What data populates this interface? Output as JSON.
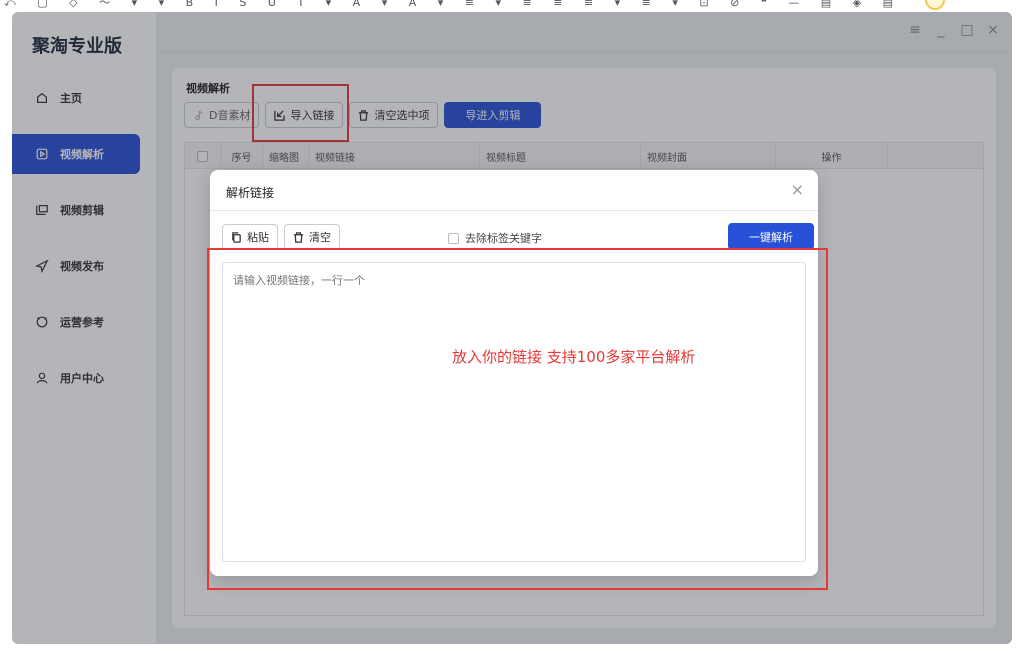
{
  "sidebar": {
    "brand": "聚淘专业版",
    "items": [
      {
        "label": "主页",
        "icon": "home-icon"
      },
      {
        "label": "视频解析",
        "icon": "play-icon"
      },
      {
        "label": "视频剪辑",
        "icon": "edit-icon"
      },
      {
        "label": "视频发布",
        "icon": "send-icon"
      },
      {
        "label": "运营参考",
        "icon": "badge-icon"
      },
      {
        "label": "用户中心",
        "icon": "user-icon"
      }
    ],
    "active_index": 1
  },
  "window_controls": {
    "menu": "≡",
    "minimize": "_",
    "maximize": "□",
    "close": "×"
  },
  "main": {
    "section_title": "视频解析",
    "toolbar": {
      "douyin_material": "D音素材",
      "import_links": "导入链接",
      "clear_selected": "清空选中项",
      "import_to_edit": "导进入剪辑"
    },
    "table_columns": [
      "序号",
      "缩略图",
      "视频链接",
      "视频标题",
      "视频封面",
      "操作"
    ]
  },
  "dialog": {
    "title": "解析链接",
    "close": "×",
    "paste": "粘贴",
    "clear": "清空",
    "remove_tags_checkbox": "去除标签关键字",
    "parse_button": "一键解析",
    "textarea_placeholder": "请输入视频链接，一行一个"
  },
  "annotation": {
    "text": "放入你的链接  支持100多家平台解析",
    "color": "#e53935"
  },
  "colors": {
    "accent": "#2751d8"
  }
}
